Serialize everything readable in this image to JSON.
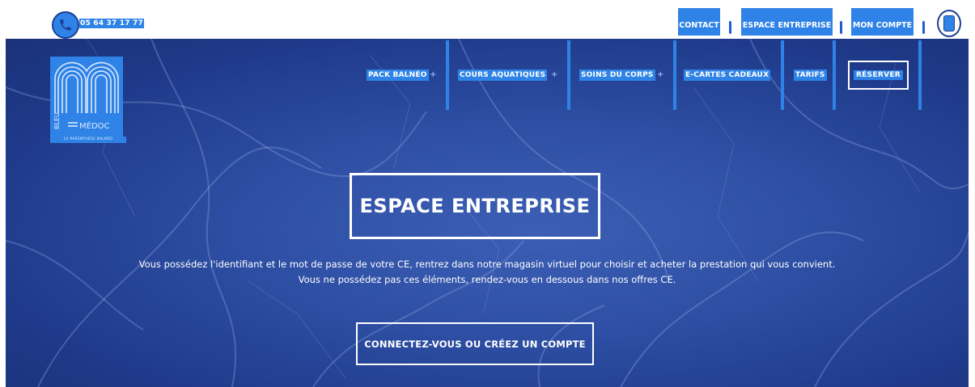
{
  "topbar": {
    "phone_icon": "phone-icon",
    "phone": "05 64 37 17 77",
    "links": [
      {
        "label": "CONTACT"
      },
      {
        "label": "ESPACE ENTREPRISE"
      },
      {
        "label": "MON COMPTE"
      }
    ],
    "account_icon": "user-account-icon"
  },
  "logo": {
    "text_bleu": "BLEU",
    "text_medoc": "MÉDOC",
    "tagline": "LA PARENTHÈSE BALNÉO"
  },
  "nav": {
    "items": [
      {
        "label": "PACK BALNÉO",
        "plus": "+"
      },
      {
        "label": "COURS AQUATIQUES",
        "plus": "+"
      },
      {
        "label": "SOINS DU CORPS",
        "plus": "+"
      },
      {
        "label": "E-CARTES CADEAUX"
      },
      {
        "label": "TARIFS"
      }
    ],
    "reserve_label": "RÉSERVER"
  },
  "hero": {
    "title": "ESPACE ENTREPRISE",
    "description_line1": "Vous possédez l'identifiant et le mot de passe de votre CE, rentrez dans notre magasin virtuel pour choisir et acheter la prestation qui vous convient.",
    "description_line2": "Vous ne possédez pas ces éléments, rendez-vous en dessous dans nos offres CE.",
    "cta_label": "CONNECTEZ-VOUS OU CRÉEZ UN COMPTE"
  },
  "colors": {
    "accent": "#2f83e6",
    "hero_background": "#2d4ea3",
    "text_on_hero": "#ffffff"
  }
}
